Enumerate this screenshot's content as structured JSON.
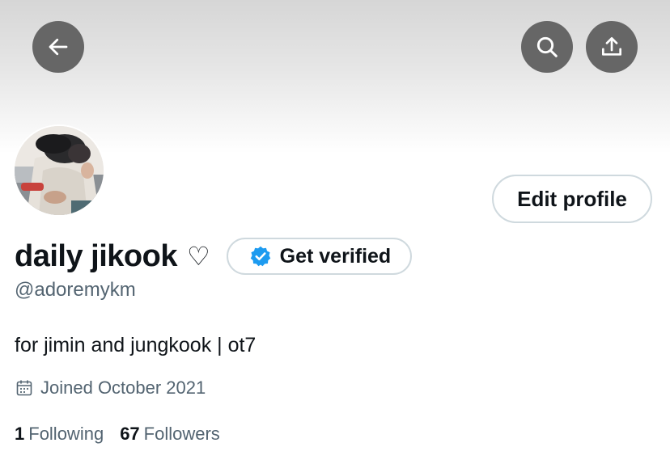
{
  "header": {
    "back_icon": "arrow-left-icon",
    "search_icon": "search-icon",
    "share_icon": "share-upload-icon"
  },
  "profile": {
    "display_name": "daily jikook",
    "name_emoji": "♡",
    "handle": "@adoremykm",
    "bio": "for jimin and jungkook | ot7",
    "joined": "Joined October 2021",
    "joined_icon": "calendar-icon",
    "edit_button": "Edit profile",
    "verify_button": "Get verified",
    "verify_icon": "verified-badge-icon",
    "verified_color": "#1d9bf0"
  },
  "stats": {
    "following_count": "1",
    "following_label": "Following",
    "followers_count": "67",
    "followers_label": "Followers"
  }
}
